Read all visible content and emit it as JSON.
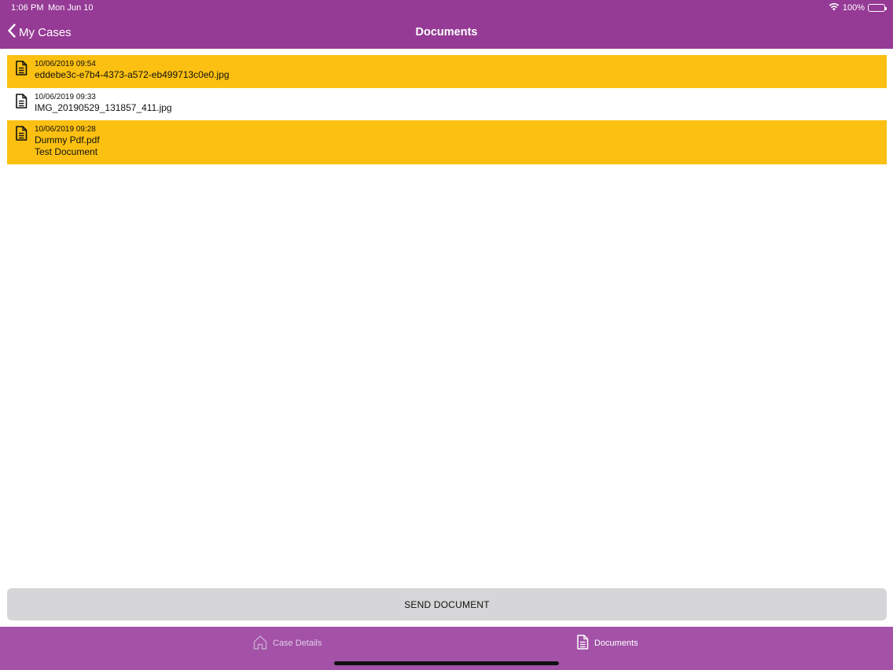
{
  "status_bar": {
    "time": "1:06 PM",
    "date": "Mon Jun 10",
    "battery_text": "100%",
    "icons": [
      "wifi-icon",
      "battery-icon"
    ]
  },
  "nav": {
    "back_label": "My Cases",
    "title": "Documents"
  },
  "documents": [
    {
      "date": "10/06/2019 09:54",
      "name": "eddebe3c-e7b4-4373-a572-eb499713c0e0.jpg",
      "description": "",
      "highlighted": true
    },
    {
      "date": "10/06/2019 09:33",
      "name": "IMG_20190529_131857_411.jpg",
      "description": "",
      "highlighted": false
    },
    {
      "date": "10/06/2019 09:28",
      "name": "Dummy Pdf.pdf",
      "description": "Test Document",
      "highlighted": true
    }
  ],
  "send_button": {
    "label": "SEND DOCUMENT"
  },
  "tabs": [
    {
      "label": "Case Details",
      "icon": "home-icon",
      "active": false
    },
    {
      "label": "Documents",
      "icon": "document-icon",
      "active": true
    }
  ],
  "colors": {
    "header": "#953a95",
    "tab_bar": "#a352a8",
    "highlight": "#fbc011",
    "button": "#d6d6d8"
  }
}
